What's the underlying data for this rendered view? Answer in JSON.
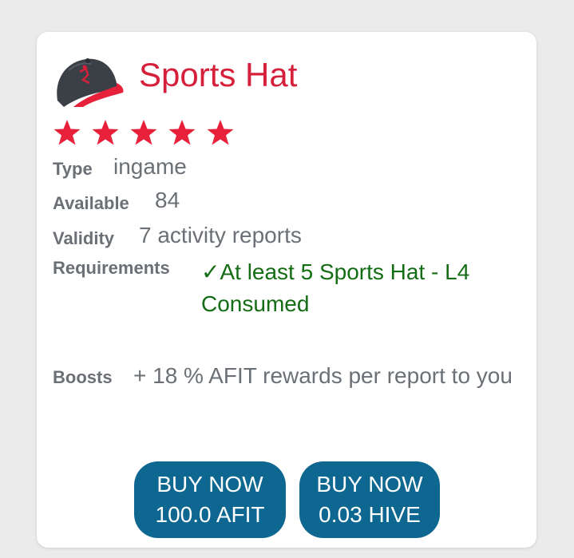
{
  "item": {
    "name": "Sports Hat",
    "rating": 5,
    "icon": "baseball-cap-icon",
    "colors": {
      "title": "#d61f3a",
      "star": "#e8213b",
      "requirement": "#146c14",
      "button": "#0e6790"
    }
  },
  "details": {
    "type_label": "Type",
    "type_value": "ingame",
    "available_label": "Available",
    "available_value": "84",
    "validity_label": "Validity",
    "validity_value": "7 activity reports",
    "requirements_label": "Requirements",
    "requirements_value": "✓At least 5 Sports Hat - L4 Consumed",
    "boosts_label": "Boosts",
    "boosts_value": "+ 18 % AFIT rewards per report to you"
  },
  "buttons": {
    "afit": {
      "line1": "BUY NOW",
      "line2": "100.0 AFIT"
    },
    "hive": {
      "line1": "BUY NOW",
      "line2": "0.03 HIVE"
    }
  }
}
